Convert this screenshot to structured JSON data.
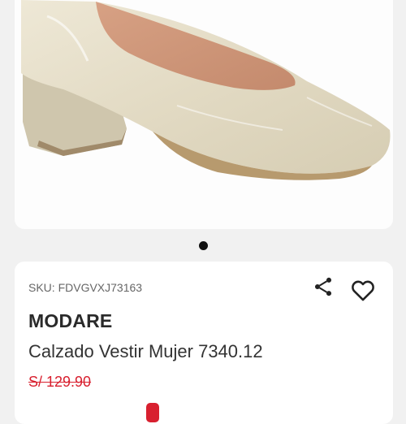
{
  "gallery": {
    "image_alt": "beige patent leather block-heel pump",
    "active_index": 0,
    "dots": 1
  },
  "product": {
    "sku": "SKU: FDVGVXJ73163",
    "brand": "MODARE",
    "name": "Calzado Vestir Mujer 7340.12",
    "old_price": "S/ 129.90",
    "current_price": "",
    "discount": ""
  },
  "icons": {
    "share": "share-icon",
    "favorite": "heart-icon"
  },
  "colors": {
    "accent_red": "#d8202f",
    "background": "#f1f1f1",
    "card": "#ffffff"
  }
}
